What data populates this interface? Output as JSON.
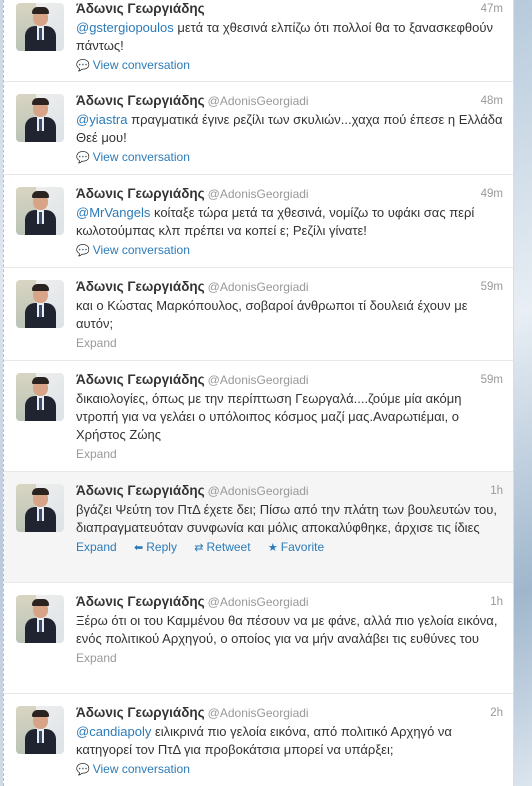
{
  "tweets": [
    {
      "name": "Άδωνις Γεωργιάδης",
      "handle": "",
      "time": "47m",
      "mention": "@gstergiopoulos",
      "text": " μετά τα χθεσινά ελπίζω ότι πολλοί θα το ξανασκεφθούν πάντως!",
      "action": "View conversation"
    },
    {
      "name": "Άδωνις Γεωργιάδης",
      "handle": "@AdonisGeorgiadi",
      "time": "48m",
      "mention": "@yiastra",
      "text": " πραγματικά έγινε ρεζίλι των σκυλιών...χαχα πού έπεσε η Ελλάδα Θεέ μου!",
      "action": "View conversation"
    },
    {
      "name": "Άδωνις Γεωργιάδης",
      "handle": "@AdonisGeorgiadi",
      "time": "49m",
      "mention": "@MrVangels",
      "text": " κοίταξε τώρα μετά τα χθεσινά, νομίζω το υφάκι σας περί κωλοτούμπας κλπ πρέπει να κοπεί ε; Ρεζίλι γίνατε!",
      "action": "View conversation"
    },
    {
      "name": "Άδωνις Γεωργιάδης",
      "handle": "@AdonisGeorgiadi",
      "time": "59m",
      "mention": "",
      "text": "και ο Κώστας Μαρκόπουλος, σοβαροί άνθρωποι τί δουλειά έχουν με αυτόν;",
      "action": "Expand"
    },
    {
      "name": "Άδωνις Γεωργιάδης",
      "handle": "@AdonisGeorgiadi",
      "time": "59m",
      "mention": "",
      "text": "δικαιολογίες, όπως με την περίπτωση Γεωργαλά....ζούμε μία ακόμη ντροπή για να γελάει ο υπόλοιπος κόσμος μαζί μας.Αναρωτιέμαι, ο Χρήστος Ζώης",
      "action": "Expand"
    },
    {
      "name": "Άδωνις Γεωργιάδης",
      "handle": "@AdonisGeorgiadi",
      "time": "1h",
      "mention": "",
      "text": "βγάζει Ψεύτη τον ΠτΔ έχετε δει; Πίσω από την πλάτη των βουλευτών του, διαπραγματευόταν συνφωνία και μόλις αποκαλύφθηκε, άρχισε τις ίδιες",
      "action": "Expand",
      "reply": "Reply",
      "retweet": "Retweet",
      "favorite": "Favorite"
    },
    {
      "name": "Άδωνις Γεωργιάδης",
      "handle": "@AdonisGeorgiadi",
      "time": "1h",
      "mention": "",
      "text": "Ξέρω ότι οι του Καμμένου θα πέσουν να με φάνε, αλλά πιο γελοία εικόνα, ενός πολιτικού Αρχηγού, ο οποίος για να μήν αναλάβει τις ευθύνες του",
      "action": "Expand"
    },
    {
      "name": "Άδωνις Γεωργιάδης",
      "handle": "@AdonisGeorgiadi",
      "time": "2h",
      "mention": "@candiapoly",
      "text": " ειλικρινά πιο γελοία εικόνα, από πολιτικό Αρχηγό να κατηγορεί τον ΠτΔ για προβοκάτσια μπορεί να υπάρξει;",
      "action": "View conversation"
    }
  ]
}
